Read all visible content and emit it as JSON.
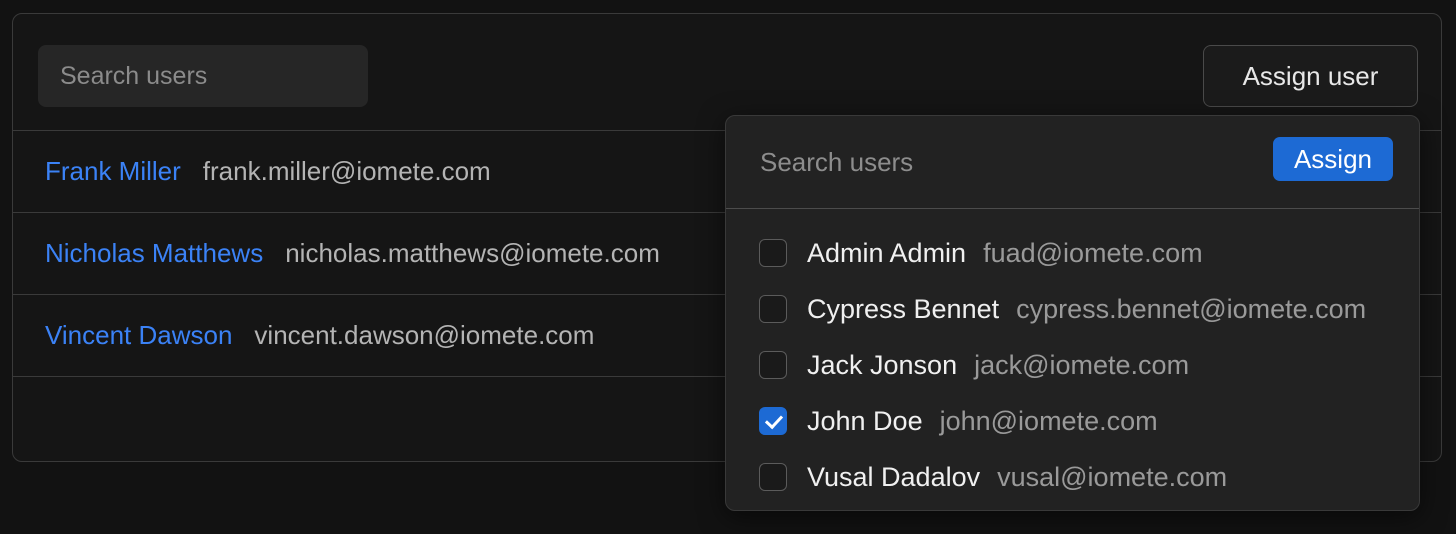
{
  "theme": {
    "page_background": "#121212",
    "card_background": "#151515",
    "dropdown_background": "#222222",
    "accent_blue": "#1d6ad4",
    "link_blue": "#3b82f6",
    "border": "#3a3a3a"
  },
  "card": {
    "toolbar": {
      "search": {
        "placeholder": "Search users",
        "value": ""
      },
      "assign_user_label": "Assign user"
    },
    "columns": [
      "name",
      "email"
    ],
    "rows": [
      {
        "name": "Frank Miller",
        "email": "frank.miller@iomete.com"
      },
      {
        "name": "Nicholas Matthews",
        "email": "nicholas.matthews@iomete.com"
      },
      {
        "name": "Vincent Dawson",
        "email": "vincent.dawson@iomete.com"
      }
    ]
  },
  "dropdown": {
    "search": {
      "placeholder": "Search users",
      "value": ""
    },
    "assign_label": "Assign",
    "items": [
      {
        "name": "Admin Admin",
        "email": "fuad@iomete.com",
        "checked": false
      },
      {
        "name": "Cypress Bennet",
        "email": "cypress.bennet@iomete.com",
        "checked": false
      },
      {
        "name": "Jack Jonson",
        "email": "jack@iomete.com",
        "checked": false
      },
      {
        "name": "John Doe",
        "email": "john@iomete.com",
        "checked": true
      },
      {
        "name": "Vusal Dadalov",
        "email": "vusal@iomete.com",
        "checked": false
      }
    ]
  }
}
